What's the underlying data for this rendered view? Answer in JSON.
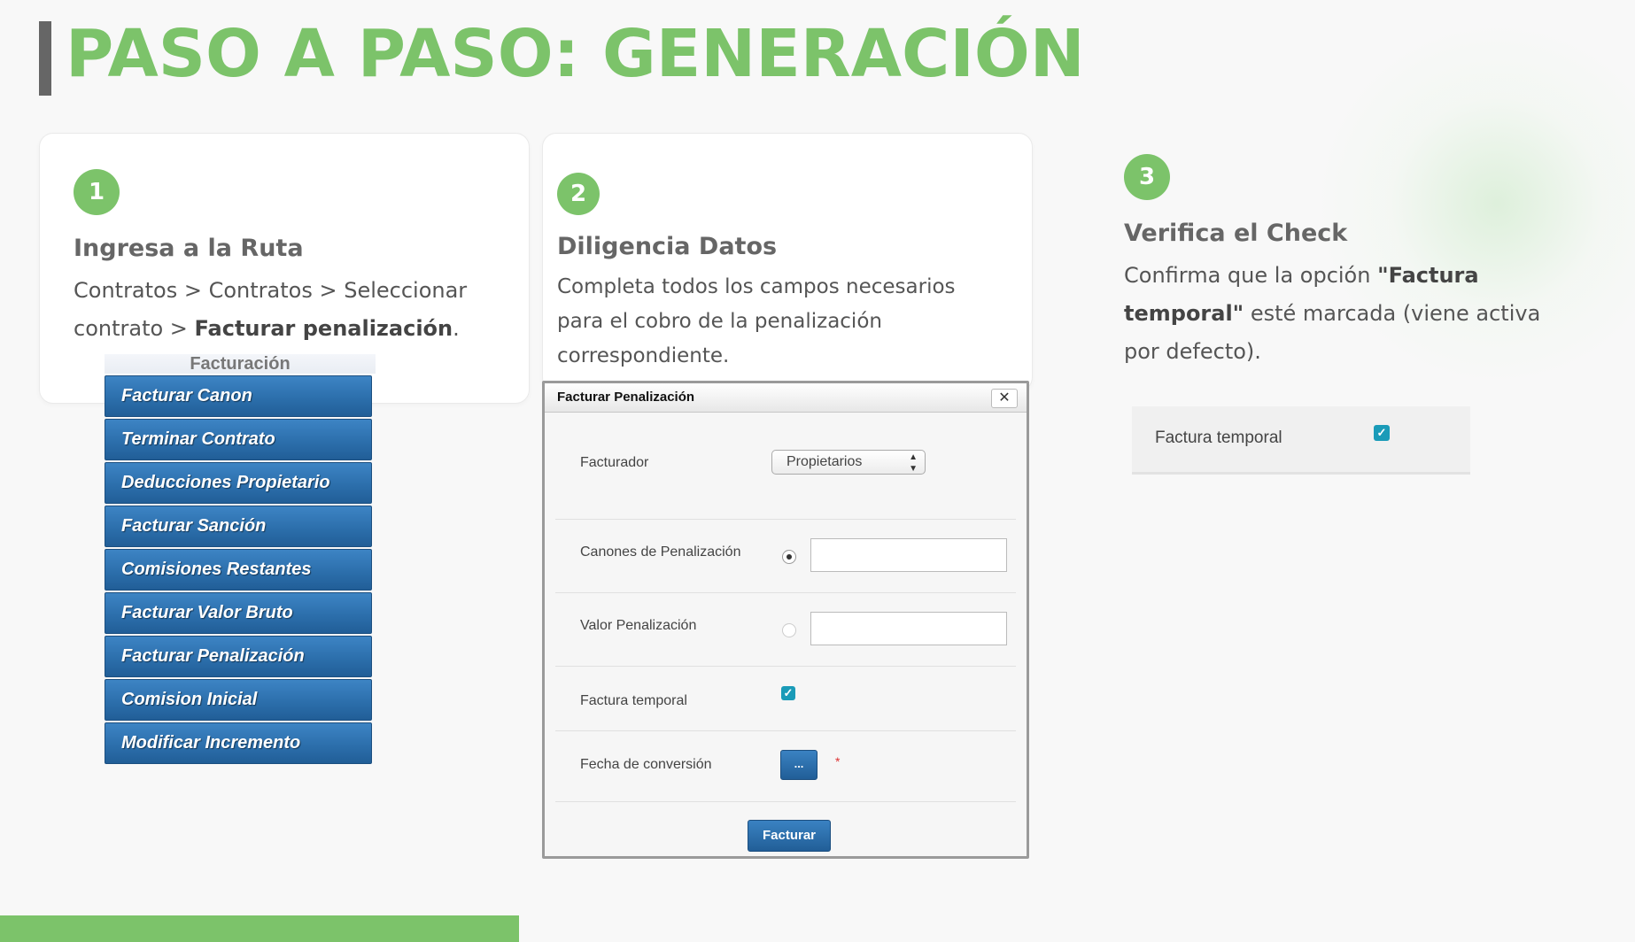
{
  "page": {
    "title": "PASO A PASO: GENERACIÓN",
    "accent_color": "#7cc36a"
  },
  "step1": {
    "number": "1",
    "title": "Ingresa a la Ruta",
    "text_plain": "Contratos > Contratos > Seleccionar contrato > ",
    "text_bold": "Facturar penalización",
    "text_end": ".",
    "menu": {
      "header": "Facturación",
      "items": [
        "Facturar Canon",
        "Terminar Contrato",
        "Deducciones Propietario",
        "Facturar Sanción",
        "Comisiones Restantes",
        "Facturar Valor Bruto",
        "Facturar Penalización",
        "Comision Inicial",
        "Modificar Incremento"
      ]
    }
  },
  "step2": {
    "number": "2",
    "title": "Diligencia Datos",
    "text": "Completa todos los campos necesarios para el cobro de la penalización correspondiente.",
    "dialog": {
      "title": "Facturar Penalización",
      "close": "✕",
      "facturador_label": "Facturador",
      "facturador_value": "Propietarios",
      "canones_label": "Canones de Penalización",
      "valor_label": "Valor Penalización",
      "temporal_label": "Factura temporal",
      "fecha_label": "Fecha de conversión",
      "fecha_button": "...",
      "required_mark": "*",
      "submit": "Facturar"
    }
  },
  "step3": {
    "number": "3",
    "title": "Verifica el Check",
    "text_a": "Confirma que la opción ",
    "text_bold": "\"Factura temporal\"",
    "text_b": " esté marcada (viene activa por defecto).",
    "snippet_label": "Factura temporal"
  }
}
